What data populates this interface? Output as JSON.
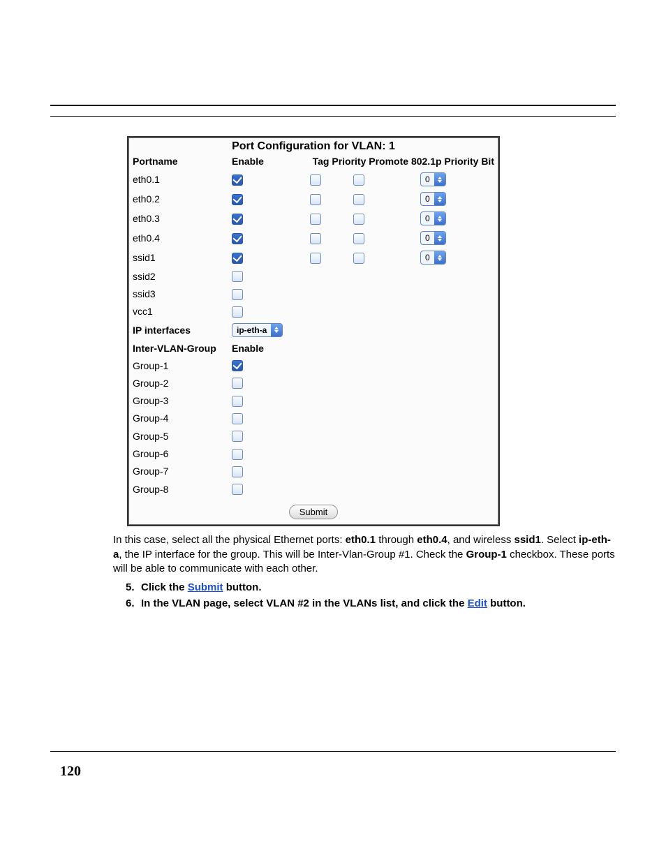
{
  "panel": {
    "title": "Port Configuration for VLAN: 1",
    "headers": {
      "portname": "Portname",
      "enable": "Enable",
      "tag": "Tag",
      "priority_promote": "Priority Promote",
      "priority_bits": "802.1p Priority Bit"
    },
    "ports": [
      {
        "name": "eth0.1",
        "enable": true,
        "has_extra": true,
        "tag": false,
        "promote": false,
        "bits": "0"
      },
      {
        "name": "eth0.2",
        "enable": true,
        "has_extra": true,
        "tag": false,
        "promote": false,
        "bits": "0"
      },
      {
        "name": "eth0.3",
        "enable": true,
        "has_extra": true,
        "tag": false,
        "promote": false,
        "bits": "0"
      },
      {
        "name": "eth0.4",
        "enable": true,
        "has_extra": true,
        "tag": false,
        "promote": false,
        "bits": "0"
      },
      {
        "name": "ssid1",
        "enable": true,
        "has_extra": true,
        "tag": false,
        "promote": false,
        "bits": "0"
      },
      {
        "name": "ssid2",
        "enable": false,
        "has_extra": false
      },
      {
        "name": "ssid3",
        "enable": false,
        "has_extra": false
      },
      {
        "name": "vcc1",
        "enable": false,
        "has_extra": false
      }
    ],
    "ip_interfaces": {
      "label": "IP interfaces",
      "value": "ip-eth-a"
    },
    "inter_vlan": {
      "label": "Inter-VLAN-Group",
      "enable_header": "Enable",
      "groups": [
        {
          "name": "Group-1",
          "enable": true
        },
        {
          "name": "Group-2",
          "enable": false
        },
        {
          "name": "Group-3",
          "enable": false
        },
        {
          "name": "Group-4",
          "enable": false
        },
        {
          "name": "Group-5",
          "enable": false
        },
        {
          "name": "Group-6",
          "enable": false
        },
        {
          "name": "Group-7",
          "enable": false
        },
        {
          "name": "Group-8",
          "enable": false
        }
      ]
    },
    "submit_label": "Submit"
  },
  "paragraph": {
    "t1": "In this case, select all the physical Ethernet ports: ",
    "b1": "eth0.1",
    "t2": " through ",
    "b2": "eth0.4",
    "t3": ", and wireless ",
    "b3": "ssid1",
    "t4": ". Select ",
    "b4": "ip-eth-a",
    "t5": ", the IP interface for the group. This will be Inter-Vlan-Group #1. Check the ",
    "b5": "Group-1",
    "t6": " checkbox. These ports will be able to communicate with each other."
  },
  "steps": {
    "s5": {
      "pre": "Click the ",
      "link": "Submit",
      "post": " button."
    },
    "s6": {
      "pre": "In the VLAN page, select VLAN #2 in the VLANs list, and click the ",
      "link": "Edit",
      "post": " button."
    }
  },
  "page_number": "120"
}
